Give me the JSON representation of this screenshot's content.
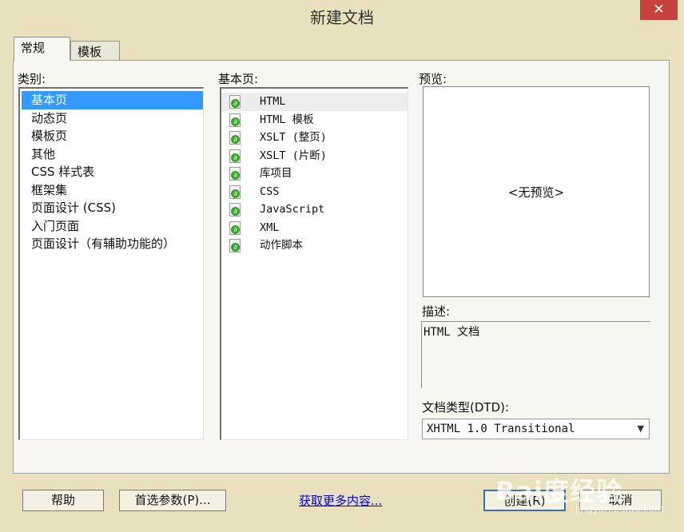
{
  "window": {
    "title": "新建文档",
    "close_glyph": "✕"
  },
  "tabs": [
    {
      "label": "常规",
      "active": true
    },
    {
      "label": "模板",
      "active": false
    }
  ],
  "category": {
    "label": "类别:",
    "items": [
      "基本页",
      "动态页",
      "模板页",
      "其他",
      "CSS 样式表",
      "框架集",
      "页面设计 (CSS)",
      "入门页面",
      "页面设计（有辅助功能的）"
    ],
    "selected_index": 0
  },
  "basic_page": {
    "label": "基本页:",
    "items": [
      "HTML",
      "HTML 模板",
      "XSLT (整页)",
      "XSLT (片断)",
      "库项目",
      "CSS",
      "JavaScript",
      "XML",
      "动作脚本"
    ],
    "selected_index": 0,
    "item_icon": "dreamweaver-file-icon"
  },
  "preview": {
    "label": "预览:",
    "empty_text": "<无预览>"
  },
  "description": {
    "label": "描述:",
    "text": "HTML 文档"
  },
  "doctype": {
    "label": "文档类型(DTD):",
    "value": "XHTML 1.0 Transitional"
  },
  "buttons": {
    "help": "帮助",
    "preferences": "首选参数(P)...",
    "more_content": "获取更多内容...",
    "create": "创建(R)",
    "cancel": "取消"
  },
  "watermark": {
    "text": "Bai度经验",
    "sub": "jingyan.baidu.com"
  },
  "colors": {
    "selection": "#3399ff",
    "window_bg": "#e9e1bd",
    "close_button": "#c7423b",
    "link": "#0000ee"
  }
}
